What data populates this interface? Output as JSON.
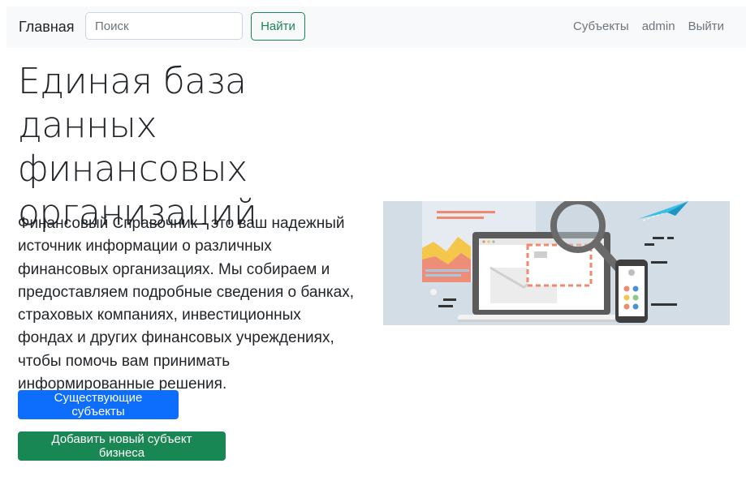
{
  "navbar": {
    "brand": "Главная",
    "search_placeholder": "Поиск",
    "search_button": "Найти",
    "links": {
      "subjects": "Субъекты",
      "user": "admin",
      "logout": "Выйти"
    }
  },
  "hero": {
    "title": "Единая база данных финансовых организаций",
    "description": "Финансовый Справочник - это ваш надежный источник информации о различных финансовых организациях. Мы собираем и предоставляем подробные сведения о банках, страховых компаниях, инвестиционных фондах и других финансовых учреждениях, чтобы помочь вам принимать информированные решения.",
    "buttons": {
      "existing": "Существующие субъекты",
      "add_new": "Добавить новый субъект бизнеса"
    }
  },
  "colors": {
    "primary": "#0d6efd",
    "success": "#198754",
    "navbar_bg": "#f8f9fa",
    "illustration_bg": "#d2dde6"
  }
}
